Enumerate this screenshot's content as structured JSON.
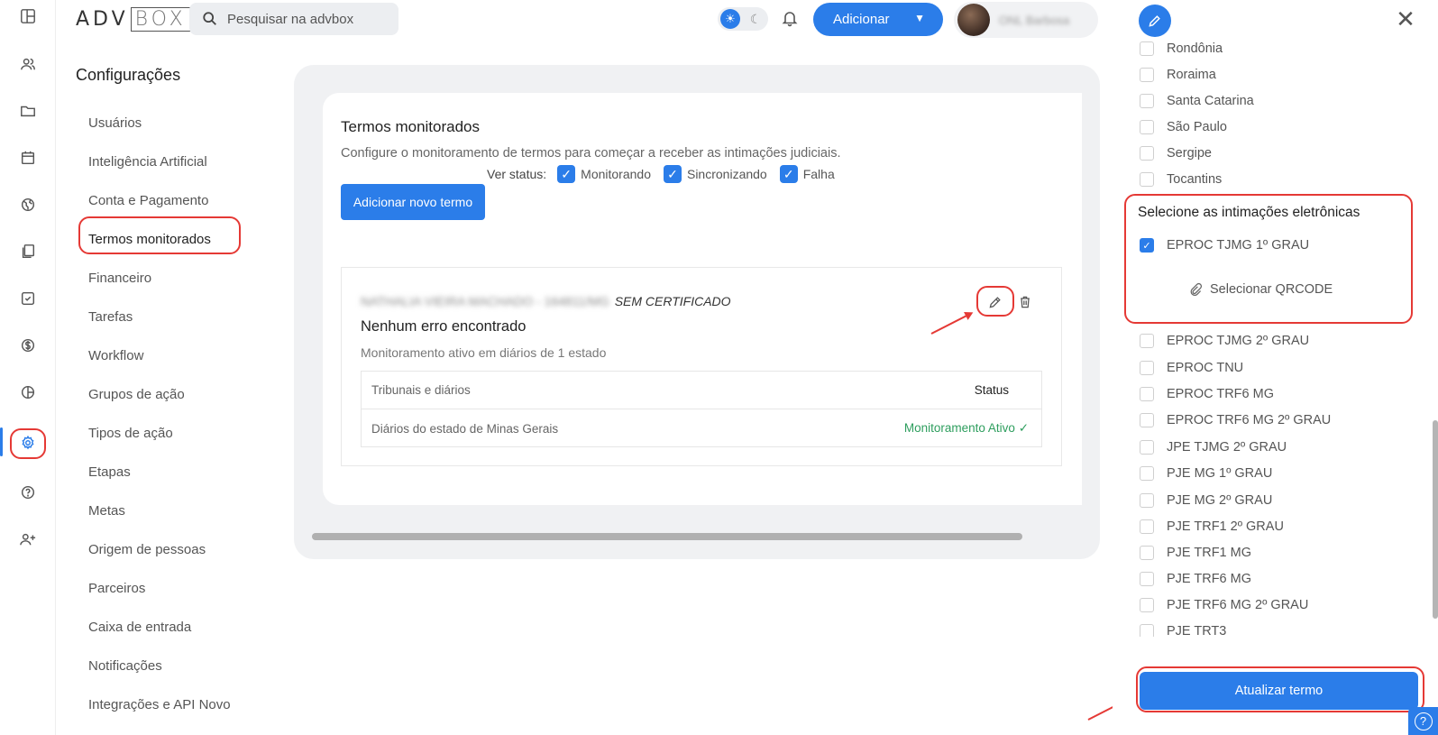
{
  "topbar": {
    "logo_left": "ADV",
    "logo_right": "BOX",
    "search_placeholder": "Pesquisar na advbox",
    "add_button": "Adicionar",
    "user_name": "ONL Barbosa"
  },
  "rail": {
    "icons": [
      "dashboard-icon",
      "people-icon",
      "folder-icon",
      "calendar-icon",
      "globe-icon",
      "documents-icon",
      "task-check-icon",
      "dollar-icon",
      "chart-pie-icon",
      "gear-icon",
      "help-icon",
      "add-person-icon"
    ],
    "active": "gear-icon"
  },
  "settings": {
    "title": "Configurações",
    "items": [
      "Usuários",
      "Inteligência Artificial",
      "Conta e Pagamento",
      "Termos monitorados",
      "Financeiro",
      "Tarefas",
      "Workflow",
      "Grupos de ação",
      "Tipos de ação",
      "Etapas",
      "Metas",
      "Origem de pessoas",
      "Parceiros",
      "Caixa de entrada",
      "Notificações",
      "Integrações e API Novo"
    ],
    "active_item": "Termos monitorados"
  },
  "main": {
    "title": "Termos monitorados",
    "description": "Configure o monitoramento de termos para começar a receber as intimações judiciais.",
    "status_label": "Ver status:",
    "status_filters": [
      "Monitorando",
      "Sincronizando",
      "Falha"
    ],
    "add_term_button": "Adicionar novo termo",
    "term": {
      "name_blurred": "NATHALIA VIEIRA MACHADO - 164811/MG",
      "certificate": "SEM CERTIFICADO",
      "headline": "Nenhum erro encontrado",
      "subtitle": "Monitoramento ativo em diários de 1 estado",
      "table": {
        "col_left": "Tribunais e diários",
        "col_right": "Status",
        "row_left": "Diários do estado de Minas Gerais",
        "row_right": "Monitoramento Ativo ✓"
      }
    }
  },
  "drawer": {
    "states": [
      "Rondônia",
      "Roraima",
      "Santa Catarina",
      "São Paulo",
      "Sergipe",
      "Tocantins"
    ],
    "section_title": "Selecione as intimações eletrônicas",
    "checked_item": "EPROC TJMG 1º GRAU",
    "qrcode_label": "Selecionar QRCODE",
    "items": [
      "EPROC TJMG 2º GRAU",
      "EPROC TNU",
      "EPROC TRF6 MG",
      "EPROC TRF6 MG 2º GRAU",
      "JPE TJMG 2º GRAU",
      "PJE MG 1º GRAU",
      "PJE MG 2º GRAU",
      "PJE TRF1 2º GRAU",
      "PJE TRF1 MG",
      "PJE TRF6 MG",
      "PJE TRF6 MG 2º GRAU",
      "PJE TRT3"
    ],
    "update_button": "Atualizar termo"
  },
  "colors": {
    "accent": "#2b7de9",
    "annotation": "#e53935",
    "success": "#2e9e5e"
  }
}
